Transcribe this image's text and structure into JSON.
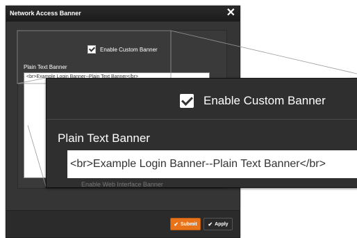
{
  "dialog": {
    "title": "Network Access Banner",
    "close_glyph": "✕",
    "enable_custom_banner_label": "Enable Custom Banner",
    "plain_text_banner_label": "Plain Text Banner",
    "banner_value": "<br>Example Login Banner--Plain Text Banner</br>",
    "enable_web_banner_label": "Enable Web Interface Banner",
    "submit_label": "Submit",
    "apply_label": "Apply",
    "check_glyph": "✔"
  },
  "zoom": {
    "enable_custom_banner_label": "Enable Custom Banner",
    "plain_text_banner_label": "Plain Text Banner",
    "banner_value": "<br>Example Login Banner--Plain Text Banner</br>",
    "enable_web_banner_label": "Enable Web Interface Banner"
  },
  "colors": {
    "submit": "#e8731a",
    "dialog_bg": "#353535"
  }
}
